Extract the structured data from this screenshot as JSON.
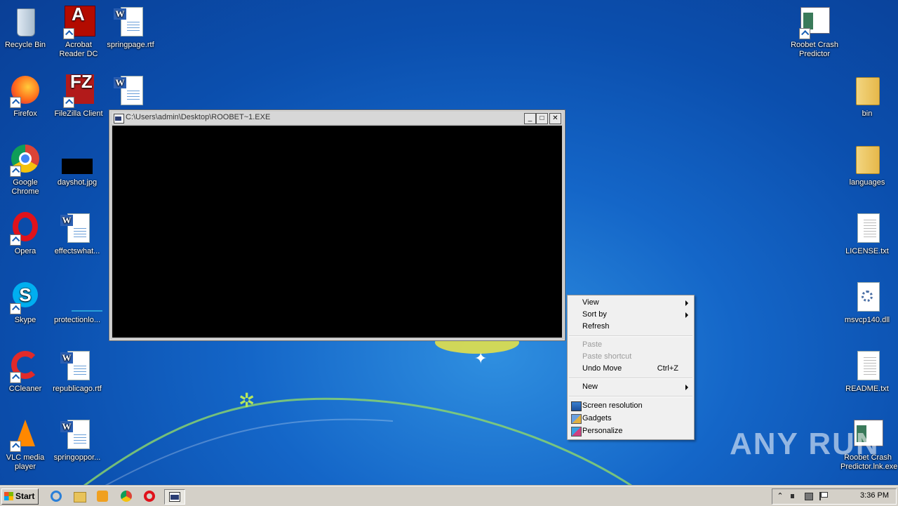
{
  "desktop": {
    "icons_left": [
      {
        "label": "Recycle Bin"
      },
      {
        "label": "Acrobat Reader DC"
      },
      {
        "label": "springpage.rtf"
      },
      {
        "label": "Firefox"
      },
      {
        "label": "FileZilla Client"
      },
      {
        "label": "Google Chrome"
      },
      {
        "label": "dayshot.jpg"
      },
      {
        "label": "Opera"
      },
      {
        "label": "effectswhat..."
      },
      {
        "label": "Skype"
      },
      {
        "label": "protectionlo..."
      },
      {
        "label": "CCleaner"
      },
      {
        "label": "republicago.rtf"
      },
      {
        "label": "VLC media player"
      },
      {
        "label": "springoppor..."
      }
    ],
    "icons_right": [
      {
        "label": "Roobet Crash Predictor"
      },
      {
        "label": "bin"
      },
      {
        "label": "languages"
      },
      {
        "label": "LICENSE.txt"
      },
      {
        "label": "msvcp140.dll"
      },
      {
        "label": "README.txt"
      },
      {
        "label": "Roobet Crash Predictor.lnk.exe"
      }
    ]
  },
  "console_window": {
    "title": "C:\\Users\\admin\\Desktop\\ROOBET~1.EXE",
    "minimize": "_",
    "maximize": "□",
    "close": "✕"
  },
  "context_menu": {
    "items": [
      {
        "label": "View",
        "submenu": true
      },
      {
        "label": "Sort by",
        "submenu": true
      },
      {
        "label": "Refresh"
      },
      {
        "label": "Paste",
        "disabled": true
      },
      {
        "label": "Paste shortcut",
        "disabled": true
      },
      {
        "label": "Undo Move",
        "shortcut": "Ctrl+Z"
      },
      {
        "label": "New",
        "submenu": true
      },
      {
        "label": "Screen resolution",
        "icon": "monitor-icon"
      },
      {
        "label": "Gadgets",
        "icon": "gadgets-icon"
      },
      {
        "label": "Personalize",
        "icon": "personalize-icon"
      }
    ]
  },
  "taskbar": {
    "start_label": "Start",
    "pinned": [
      "internet-explorer-icon",
      "explorer-icon",
      "media-player-icon",
      "chrome-icon",
      "opera-icon",
      "console-icon"
    ],
    "clock": "3:36 PM"
  },
  "watermark": "ANY RUN",
  "colors": {
    "desktop": "#1466c8",
    "taskbar": "#d4d0c8",
    "menu": "#f0f0f0"
  }
}
